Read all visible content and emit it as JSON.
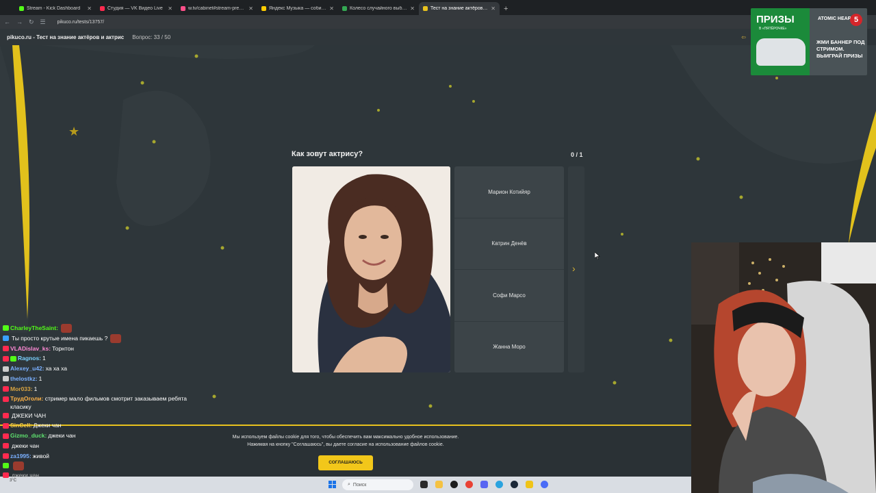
{
  "browser": {
    "tabs": [
      {
        "title": "Stream - Kick Dashboard",
        "color": "#53fc18"
      },
      {
        "title": "Студия — VK Видео Live",
        "color": "#ff2a4f"
      },
      {
        "title": "w.tv/cabinet#stream-preview",
        "color": "#ff4f8a"
      },
      {
        "title": "Яндекс Музыка — собираем",
        "color": "#ffcc00"
      },
      {
        "title": "Колесо случайного выбора",
        "color": "#34a853"
      },
      {
        "title": "Тест на знание актёров и актр",
        "color": "#e8c21e"
      }
    ],
    "url": "pikuco.ru/tests/13757/"
  },
  "site": {
    "name": "pikuco.ru - Тест на знание актёров и актрис",
    "question_counter": "Вопрос: 33 / 50"
  },
  "quiz": {
    "question": "Как зовут актрису?",
    "score": "0 / 1",
    "answers": [
      "Марион Котийяр",
      "Катрин Денёв",
      "Софи Марсо",
      "Жанна Моро"
    ]
  },
  "cookie": {
    "line1": "Мы используем файлы cookie для того, чтобы обеспечить вам максимально удобное использование.",
    "line2": "Нажимая на кнопку \"Соглашаюсь\", вы даете согласие на использование файлов cookie.",
    "button": "СОГЛАШАЮСЬ"
  },
  "chat": {
    "messages": [
      {
        "user": "CharleyTheSaint:",
        "text": "",
        "color": "#53fc18",
        "badge": "#53fc18"
      },
      {
        "user": "",
        "text": "Ты просто крутые имена пикаешь ?",
        "color": "#ff2a4f",
        "badge": "#3aa0ff"
      },
      {
        "user": "VLADislav_ks:",
        "text": "Торнтон",
        "color": "#ff8ad6",
        "badge": "#ff2a4f"
      },
      {
        "user": "Ragnos:",
        "text": "1",
        "color": "#7ad0ff",
        "badge": "#ff2a4f"
      },
      {
        "user": "Alexey_u42:",
        "text": "ха ха ха",
        "color": "#7ab0ff",
        "badge": "#cccccc"
      },
      {
        "user": "thelostkz:",
        "text": "1",
        "color": "#7ab0ff",
        "badge": "#cccccc"
      },
      {
        "user": "Mor033:",
        "text": "1",
        "color": "#d9a441",
        "badge": "#ff2a4f"
      },
      {
        "user": "ТрудОголи:",
        "text": "стример мало фильмов смотрит заказываем ребята класику",
        "color": "#ffb347",
        "badge": "#ff2a4f"
      },
      {
        "user": "",
        "text": "ДЖЕКИ ЧАН",
        "color": "#ff6a3a",
        "badge": "#ff2a4f"
      },
      {
        "user": "SinCell:",
        "text": "Джеки чан",
        "color": "#ffd24a",
        "badge": "#ff2a4f"
      },
      {
        "user": "Gizmo_duck:",
        "text": "джеки чан",
        "color": "#5ee06e",
        "badge": "#ff2a4f"
      },
      {
        "user": "",
        "text": "джеки чан",
        "color": "#3a7aff",
        "badge": "#ff2a4f"
      },
      {
        "user": "za1995:",
        "text": "живой",
        "color": "#7ab0ff",
        "badge": "#ff2a4f"
      },
      {
        "user": "",
        "text": "",
        "color": "#c77aff",
        "badge": "#53fc18"
      },
      {
        "user": "",
        "text": "джеки чан",
        "color": "#a0a0a0",
        "badge": "#ff2a4f"
      }
    ]
  },
  "taskbar": {
    "weather": "3°C",
    "search_placeholder": "Поиск"
  },
  "ad": {
    "prizes": "ПРИЗЫ",
    "sub": "В «ПЯТЁРОЧКЕ»",
    "brand": "ATOMIC HEART",
    "number": "5",
    "cta": "ЖМИ БАННЕР ПОД СТРИМОМ. ВЫИГРАЙ ПРИЗЫ"
  },
  "colors": {
    "accent": "#e8c21e",
    "page_bg": "#2e363a"
  }
}
